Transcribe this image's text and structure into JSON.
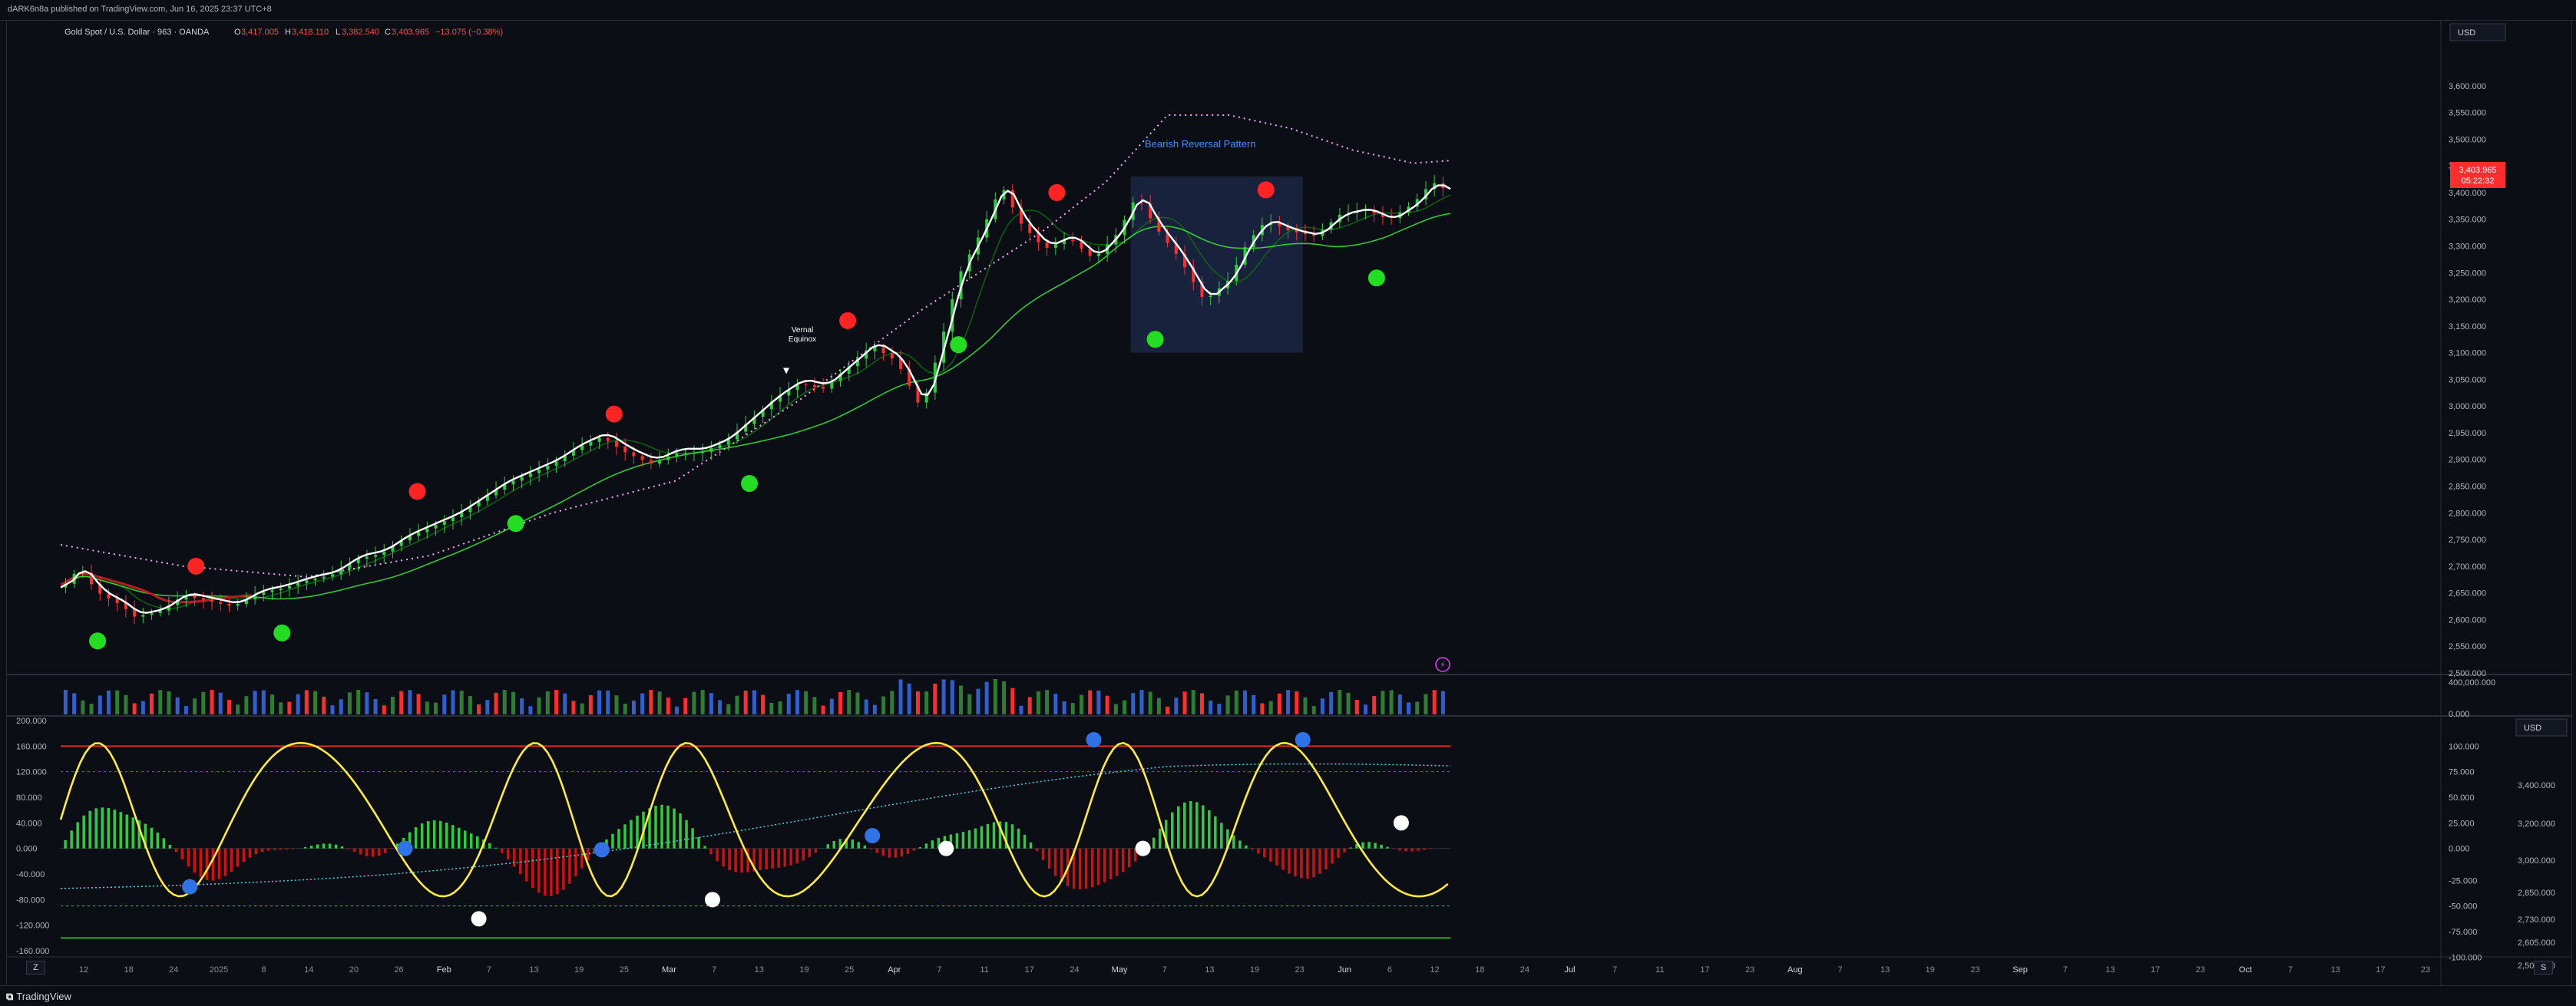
{
  "header": {
    "publisher": "dARK6n8a published on TradingView.com, Jun 16, 2025 23:37 UTC+8"
  },
  "legend": {
    "symbol": "Gold Spot / U.S. Dollar · 963 · OANDA",
    "open_label": "O",
    "open": "3,417.005",
    "high_label": "H",
    "high": "3,418.110",
    "low_label": "L",
    "low": "3,382.540",
    "close_label": "C",
    "close": "3,403.965",
    "change": "−13.075 (−0.38%)"
  },
  "currency": "USD",
  "last_price": {
    "value": "3,403.965",
    "countdown": "05:22:32"
  },
  "annotations": {
    "pattern": "Bearish Reversal Pattern",
    "equinox_1": "Vernal",
    "equinox_2": "Equinox"
  },
  "x_axis": [
    "12",
    "18",
    "24",
    "2025",
    "8",
    "14",
    "20",
    "26",
    "Feb",
    "7",
    "13",
    "19",
    "25",
    "Mar",
    "7",
    "13",
    "19",
    "25",
    "Apr",
    "7",
    "11",
    "17",
    "24",
    "May",
    "7",
    "13",
    "19",
    "23",
    "Jun",
    "6",
    "12",
    "18",
    "24",
    "Jul",
    "7",
    "11",
    "17",
    "23",
    "Aug",
    "7",
    "13",
    "19",
    "23",
    "Sep",
    "7",
    "13",
    "17",
    "23",
    "Oct",
    "7",
    "13",
    "17",
    "23"
  ],
  "footer": {
    "brand": "TradingView",
    "btn_left": "Z",
    "btn_right": "S"
  },
  "colors": {
    "up": "#2ecc40",
    "down": "#ff2d2d",
    "signal_up": "#22dd22",
    "signal_down": "#ff2424",
    "blue_dot": "#2f73e6",
    "white_line": "#ffffff",
    "osc_line": "#ffeb3b",
    "bg": "#0c0e15"
  },
  "chart_data": [
    {
      "type": "line",
      "title": "Gold Spot / U.S. Dollar · 963 · OANDA",
      "ylim": [
        2500,
        3650
      ],
      "y_ticks": [
        "3,600.000",
        "3,550.000",
        "3,500.000",
        "3,450.000",
        "3,400.000",
        "3,350.000",
        "3,300.000",
        "3,250.000",
        "3,200.000",
        "3,150.000",
        "3,100.000",
        "3,050.000",
        "3,000.000",
        "2,950.000",
        "2,900.000",
        "2,850.000",
        "2,800.000",
        "2,750.000",
        "2,700.000",
        "2,650.000",
        "2,600.000",
        "2,550.000",
        "2,500.000"
      ],
      "x_range": [
        0,
        1000
      ],
      "price": [
        [
          0,
          2660
        ],
        [
          15,
          2700
        ],
        [
          30,
          2655
        ],
        [
          50,
          2630
        ],
        [
          60,
          2610
        ],
        [
          80,
          2620
        ],
        [
          100,
          2650
        ],
        [
          120,
          2640
        ],
        [
          140,
          2630
        ],
        [
          160,
          2655
        ],
        [
          180,
          2665
        ],
        [
          200,
          2680
        ],
        [
          220,
          2690
        ],
        [
          240,
          2720
        ],
        [
          260,
          2730
        ],
        [
          280,
          2760
        ],
        [
          300,
          2780
        ],
        [
          320,
          2800
        ],
        [
          340,
          2830
        ],
        [
          360,
          2860
        ],
        [
          380,
          2880
        ],
        [
          400,
          2900
        ],
        [
          420,
          2930
        ],
        [
          440,
          2950
        ],
        [
          460,
          2920
        ],
        [
          480,
          2900
        ],
        [
          500,
          2920
        ],
        [
          520,
          2920
        ],
        [
          540,
          2940
        ],
        [
          560,
          2980
        ],
        [
          580,
          3020
        ],
        [
          600,
          3050
        ],
        [
          620,
          3040
        ],
        [
          640,
          3080
        ],
        [
          660,
          3120
        ],
        [
          680,
          3090
        ],
        [
          700,
          3000
        ],
        [
          715,
          3120
        ],
        [
          730,
          3250
        ],
        [
          750,
          3340
        ],
        [
          765,
          3420
        ],
        [
          780,
          3350
        ],
        [
          800,
          3300
        ],
        [
          820,
          3320
        ],
        [
          840,
          3280
        ],
        [
          860,
          3330
        ],
        [
          875,
          3400
        ],
        [
          890,
          3340
        ],
        [
          910,
          3280
        ],
        [
          930,
          3200
        ],
        [
          950,
          3240
        ],
        [
          965,
          3310
        ],
        [
          980,
          3350
        ],
        [
          1000,
          3330
        ],
        [
          1020,
          3320
        ],
        [
          1040,
          3360
        ],
        [
          1060,
          3370
        ],
        [
          1080,
          3350
        ],
        [
          1100,
          3380
        ],
        [
          1115,
          3420
        ],
        [
          1130,
          3400
        ]
      ],
      "upper_band": [
        [
          0,
          2740
        ],
        [
          100,
          2700
        ],
        [
          200,
          2680
        ],
        [
          300,
          2720
        ],
        [
          400,
          2800
        ],
        [
          500,
          2860
        ],
        [
          600,
          3010
        ],
        [
          700,
          3180
        ],
        [
          800,
          3330
        ],
        [
          850,
          3420
        ],
        [
          900,
          3545
        ],
        [
          950,
          3545
        ],
        [
          1000,
          3520
        ],
        [
          1050,
          3480
        ],
        [
          1100,
          3455
        ],
        [
          1130,
          3460
        ]
      ],
      "signals_sell": [
        [
          110,
          2700
        ],
        [
          290,
          2840
        ],
        [
          450,
          2985
        ],
        [
          640,
          3160
        ],
        [
          810,
          3400
        ],
        [
          980,
          3405
        ]
      ],
      "signals_buy": [
        [
          30,
          2560
        ],
        [
          180,
          2575
        ],
        [
          370,
          2780
        ],
        [
          560,
          2855
        ],
        [
          730,
          3115
        ],
        [
          890,
          3125
        ],
        [
          1070,
          3240
        ]
      ],
      "pattern_box": {
        "x": [
          870,
          1010
        ],
        "y": [
          3100,
          3430
        ]
      },
      "equinox_marker": [
        590,
        3060
      ]
    },
    {
      "type": "bar",
      "title": "",
      "ylim": [
        0,
        400000
      ],
      "y_ticks": [
        "400,000.000",
        "0.000"
      ]
    },
    {
      "type": "line",
      "title": "",
      "ylim": [
        -160,
        200
      ],
      "y_ticks_left": [
        "200.000",
        "160.000",
        "120.000",
        "80.000",
        "40.000",
        "0.000",
        "-40.000",
        "-80.000",
        "-120.000",
        "-160.000"
      ],
      "y_ticks_right_inner": [
        "100.000",
        "75.000",
        "50.000",
        "25.000",
        "0.000",
        "-25.000",
        "-50.000",
        "-75.000",
        "-100.000"
      ],
      "y_ticks_right_outer": [
        "3,400.000",
        "3,200.000",
        "3,000.000",
        "2,850.000",
        "2,730.000",
        "2,605.000",
        "2,505.000"
      ],
      "levels": [
        160,
        120,
        -90,
        -140
      ],
      "blue_dots": [
        [
          105,
          -60
        ],
        [
          280,
          0
        ],
        [
          440,
          -2
        ],
        [
          660,
          20
        ],
        [
          840,
          170
        ],
        [
          1010,
          170
        ]
      ],
      "white_dots": [
        [
          340,
          -110
        ],
        [
          530,
          -80
        ],
        [
          720,
          0
        ],
        [
          880,
          0
        ],
        [
          1090,
          40
        ]
      ]
    }
  ]
}
